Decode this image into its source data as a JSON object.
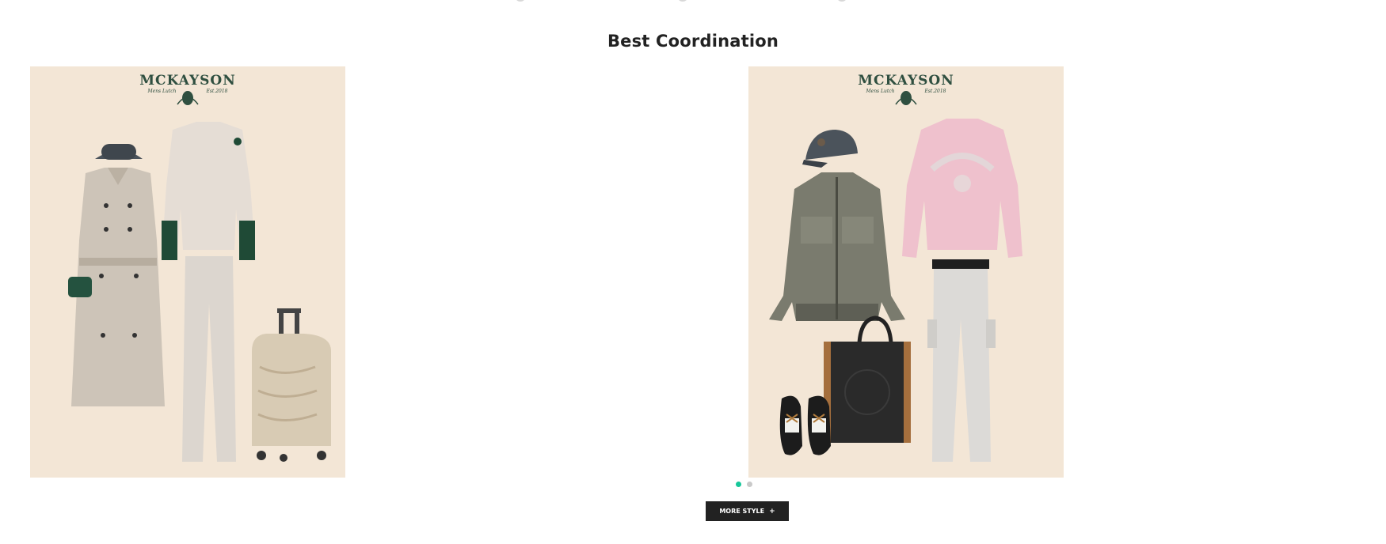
{
  "section": {
    "title": "Best Coordination"
  },
  "cards": [
    {
      "brand": "MCKAYSON",
      "sub_left": "Mens Lutch",
      "sub_right": "Est.2018"
    },
    {
      "brand": "MCKAYSON",
      "sub_left": "Mens Lutch",
      "sub_right": "Est.2018"
    }
  ],
  "pagination": {
    "total": 2,
    "active": 1
  },
  "more_button": {
    "label": "MORE STYLE",
    "icon": "+"
  },
  "colors": {
    "card_bg": "#f3e6d6",
    "brand": "#2f4f40",
    "accent": "#16c79a",
    "button": "#222222"
  }
}
